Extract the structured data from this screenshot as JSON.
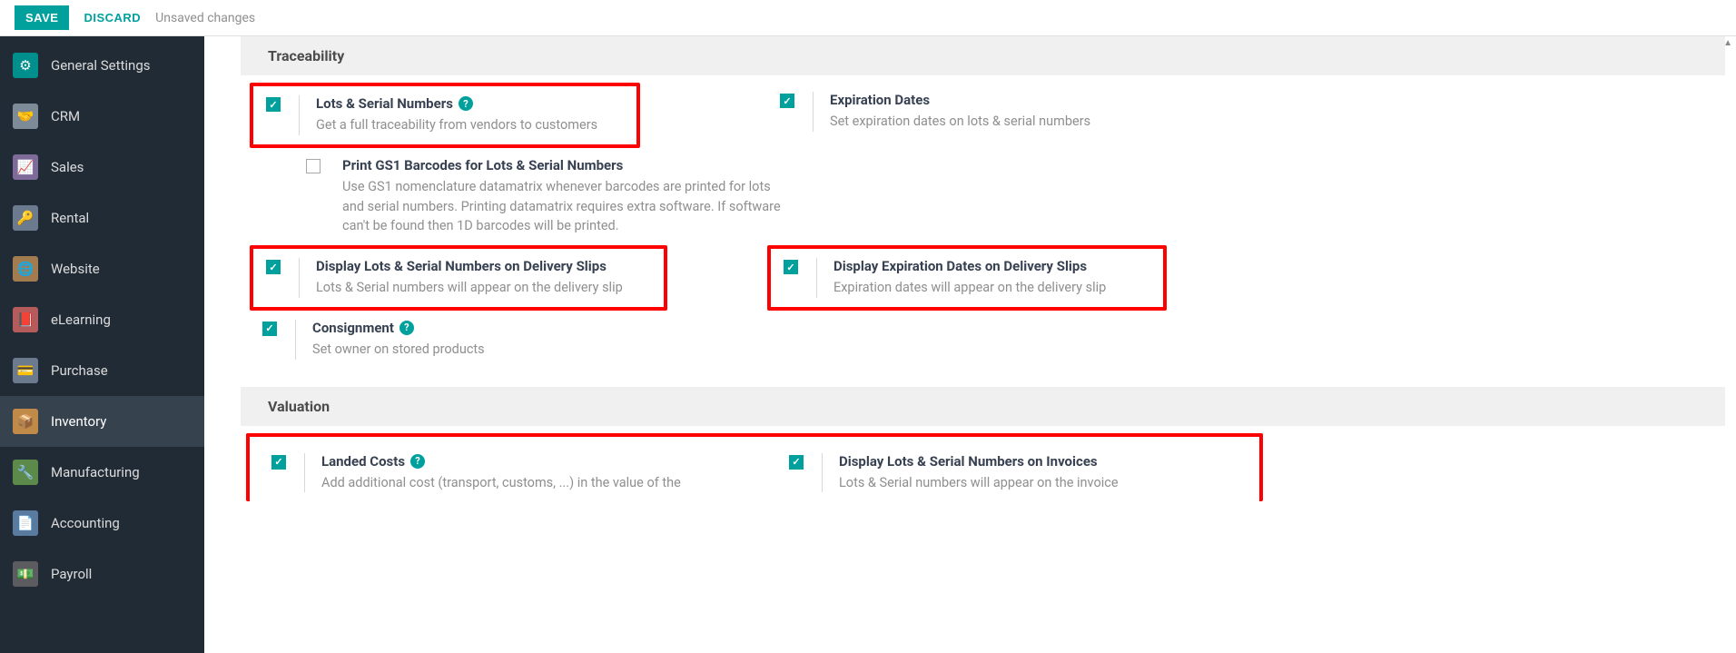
{
  "topbar": {
    "save": "SAVE",
    "discard": "DISCARD",
    "unsaved": "Unsaved changes"
  },
  "sidebar": {
    "items": [
      {
        "label": "General Settings",
        "icon": "gear",
        "color": "ic-teal"
      },
      {
        "label": "CRM",
        "icon": "handshake",
        "color": "ic-gray"
      },
      {
        "label": "Sales",
        "icon": "chart",
        "color": "ic-purple"
      },
      {
        "label": "Rental",
        "icon": "key",
        "color": "ic-slate"
      },
      {
        "label": "Website",
        "icon": "globe",
        "color": "ic-brown"
      },
      {
        "label": "eLearning",
        "icon": "book",
        "color": "ic-red"
      },
      {
        "label": "Purchase",
        "icon": "card",
        "color": "ic-slate"
      },
      {
        "label": "Inventory",
        "icon": "box",
        "color": "ic-orange",
        "active": true
      },
      {
        "label": "Manufacturing",
        "icon": "wrench",
        "color": "ic-green"
      },
      {
        "label": "Accounting",
        "icon": "doc",
        "color": "ic-blue"
      },
      {
        "label": "Payroll",
        "icon": "money",
        "color": "ic-dk"
      }
    ]
  },
  "sections": {
    "traceability": {
      "title": "Traceability",
      "lots": {
        "title": "Lots & Serial Numbers",
        "desc": "Get a full traceability from vendors to customers",
        "checked": true,
        "help": true
      },
      "expiration": {
        "title": "Expiration Dates",
        "desc": "Set expiration dates on lots & serial numbers",
        "checked": true
      },
      "gs1": {
        "title": "Print GS1 Barcodes for Lots & Serial Numbers",
        "desc": "Use GS1 nomenclature datamatrix whenever barcodes are printed for lots and serial numbers. Printing datamatrix requires extra software. If software can't be found then 1D barcodes will be printed.",
        "checked": false
      },
      "lots_slip": {
        "title": "Display Lots & Serial Numbers on Delivery Slips",
        "desc": "Lots & Serial numbers will appear on the delivery slip",
        "checked": true
      },
      "exp_slip": {
        "title": "Display Expiration Dates on Delivery Slips",
        "desc": "Expiration dates will appear on the delivery slip",
        "checked": true
      },
      "consignment": {
        "title": "Consignment",
        "desc": "Set owner on stored products",
        "checked": true,
        "help": true
      }
    },
    "valuation": {
      "title": "Valuation",
      "landed": {
        "title": "Landed Costs",
        "desc": "Add additional cost (transport, customs, ...) in the value of the",
        "checked": true,
        "help": true
      },
      "lots_inv": {
        "title": "Display Lots & Serial Numbers on Invoices",
        "desc": "Lots & Serial numbers will appear on the invoice",
        "checked": true
      }
    }
  }
}
